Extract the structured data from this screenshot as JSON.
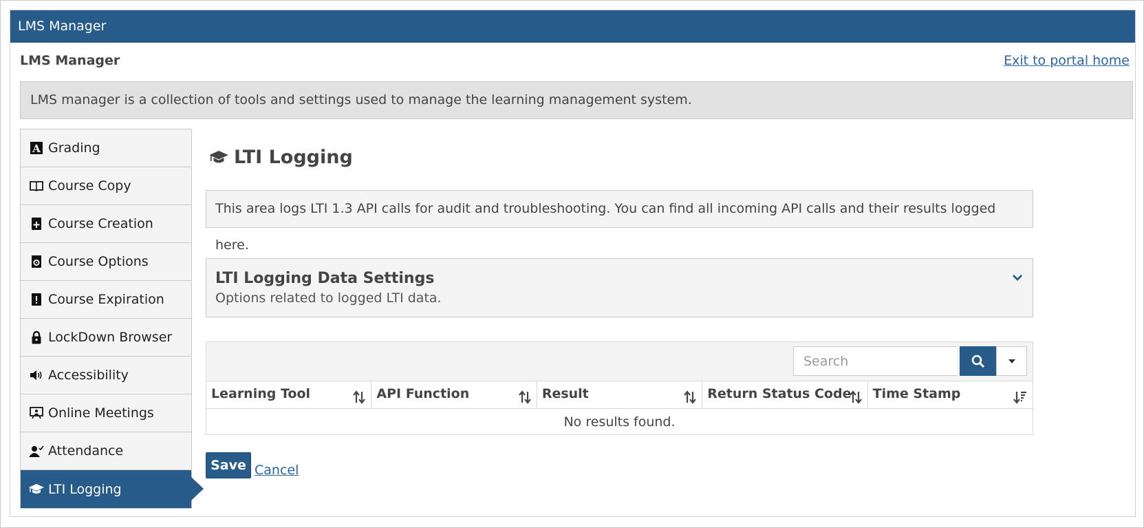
{
  "window": {
    "title": "LMS Manager"
  },
  "header": {
    "title": "LMS Manager",
    "exit_link": "Exit to portal home"
  },
  "intro": {
    "text": "LMS manager is a collection of tools and settings used to manage the learning management system."
  },
  "sidebar": {
    "items": [
      {
        "label": "Grading",
        "icon": "grading-icon"
      },
      {
        "label": "Course Copy",
        "icon": "book-icon"
      },
      {
        "label": "Course Creation",
        "icon": "course-add-icon"
      },
      {
        "label": "Course Options",
        "icon": "course-gear-icon"
      },
      {
        "label": "Course Expiration",
        "icon": "course-alert-icon"
      },
      {
        "label": "LockDown Browser",
        "icon": "lock-icon"
      },
      {
        "label": "Accessibility",
        "icon": "speaker-icon"
      },
      {
        "label": "Online Meetings",
        "icon": "presentation-icon"
      },
      {
        "label": "Attendance",
        "icon": "user-check-icon"
      },
      {
        "label": "LTI Logging",
        "icon": "graduation-cap-icon",
        "active": true
      }
    ]
  },
  "main": {
    "title": "LTI Logging",
    "info": "This area logs LTI 1.3 API calls for audit and troubleshooting. You can find all incoming API calls and their results logged here.",
    "settings": {
      "title": "LTI Logging Data Settings",
      "subtitle": "Options related to logged LTI data."
    },
    "table": {
      "search_placeholder": "Search",
      "columns": [
        "Learning Tool",
        "API Function",
        "Result",
        "Return Status Code",
        "Time Stamp"
      ],
      "empty_text": "No results found."
    },
    "save_label": "Save",
    "cancel_label": "Cancel"
  },
  "colors": {
    "primary": "#275b8a",
    "link": "#2a64a4"
  }
}
